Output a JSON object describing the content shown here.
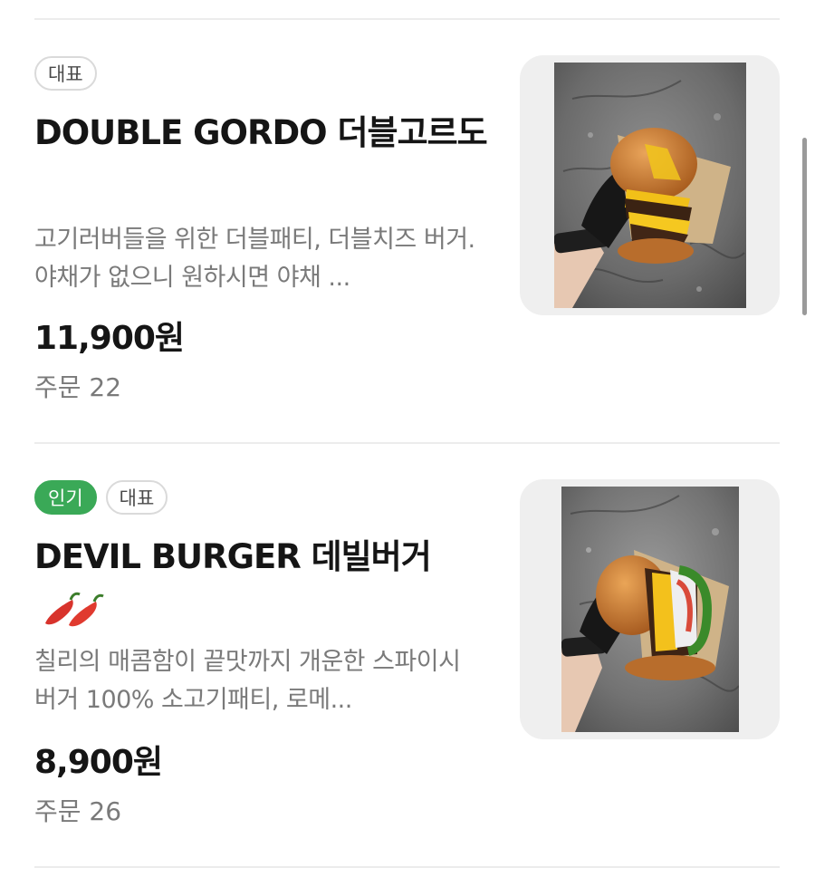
{
  "menu_items": [
    {
      "badges": [
        "대표"
      ],
      "name": "DOUBLE GORDO 더블고르도",
      "description": "고기러버들을 위한 더블패티, 더블치즈 버거. 야채가 없으니 원하시면 야채 ...",
      "price": "11,900원",
      "orders": "주문 22"
    },
    {
      "badges": [
        "인기",
        "대표"
      ],
      "name": "DEVIL BURGER 데빌버거",
      "emoji": "🌶🌶",
      "description": "칠리의 매콤함이 끝맛까지 개운한 스파이시 버거 100% 소고기패티, 로메...",
      "price": "8,900원",
      "orders": "주문 26"
    }
  ],
  "colors": {
    "popular_badge": "#3aa957",
    "divider": "#ececec",
    "muted_text": "#7a7a7a"
  }
}
